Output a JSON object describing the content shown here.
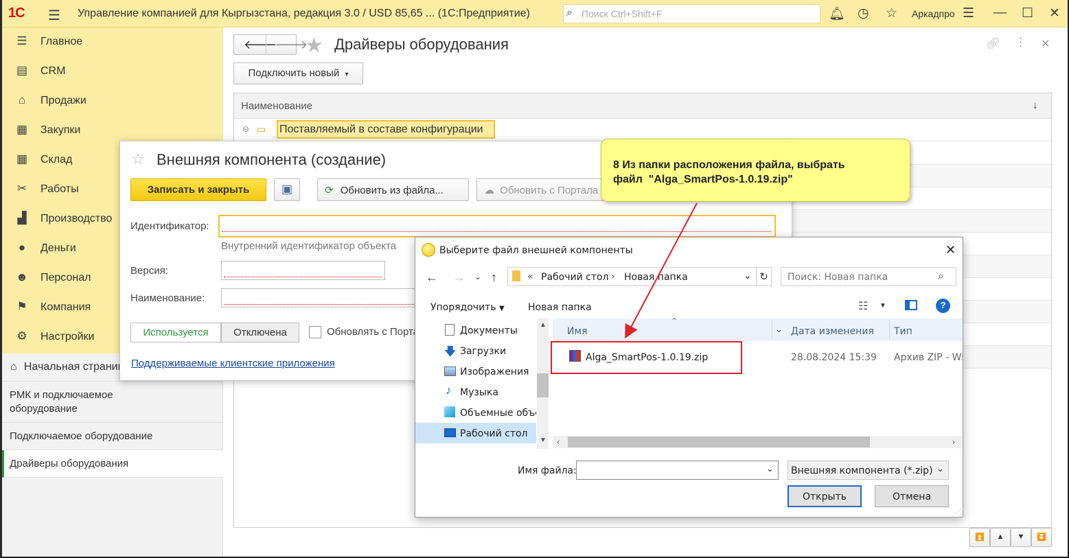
{
  "app": {
    "logo": "1С",
    "title": "Управление компанией для Кыргызстана, редакция 3.0 / USD 85,65 ... (1С:Предприятие)",
    "search_placeholder": "Поиск Ctrl+Shift+F",
    "user": "Аркадпро"
  },
  "sidebar": {
    "items": [
      {
        "label": "Главное",
        "icon": "menu-icon"
      },
      {
        "label": "CRM",
        "icon": "crm-icon"
      },
      {
        "label": "Продажи",
        "icon": "basket-icon"
      },
      {
        "label": "Закупки",
        "icon": "cart-icon"
      },
      {
        "label": "Склад",
        "icon": "warehouse-icon"
      },
      {
        "label": "Работы",
        "icon": "tools-icon"
      },
      {
        "label": "Производство",
        "icon": "factory-icon"
      },
      {
        "label": "Деньги",
        "icon": "money-icon"
      },
      {
        "label": "Персонал",
        "icon": "people-icon"
      },
      {
        "label": "Компания",
        "icon": "flag-icon"
      },
      {
        "label": "Настройки",
        "icon": "gear-icon"
      }
    ],
    "home": "Начальная страница",
    "open_windows": [
      "РМК и подключаемое оборудование",
      "Подключаемое оборудование",
      "Драйверы оборудования"
    ]
  },
  "main": {
    "title": "Драйверы оборудования",
    "connect_new": "Подключить новый",
    "column_header": "Наименование",
    "group_row": "Поставляемый в составе конфигурации"
  },
  "component_dialog": {
    "title": "Внешняя компонента (создание)",
    "save_close": "Записать и закрыть",
    "update_from_file": "Обновить из файла...",
    "update_from_portal": "Обновить с Портала",
    "identifier_label": "Идентификатор:",
    "identifier_hint": "Внутренний идентификатор объекта",
    "version_label": "Версия:",
    "name_label": "Наименование:",
    "used": "Используется",
    "disabled": "Отключена",
    "update_from_portal_check": "Обновлять с Портала",
    "supported_clients_link": "Поддерживаемые клиентские приложения"
  },
  "file_dialog": {
    "title": "Выберите файл внешней компоненты",
    "breadcrumb_prefix": "«",
    "path": [
      "Рабочий стол",
      "Новая папка"
    ],
    "search_placeholder": "Поиск: Новая папка",
    "organize": "Упорядочить",
    "new_folder": "Новая папка",
    "tree": [
      "Документы",
      "Загрузки",
      "Изображения",
      "Музыка",
      "Объемные объекты",
      "Рабочий стол"
    ],
    "columns": {
      "name": "Имя",
      "date": "Дата изменения",
      "type": "Тип"
    },
    "files": [
      {
        "name": "Alga_SmartPos-1.0.19.zip",
        "date": "28.08.2024 15:39",
        "type": "Архив ZIP - WinRAR"
      }
    ],
    "filename_label": "Имя файла:",
    "filename_value": "",
    "filter": "Внешняя компонента (*.zip)",
    "open": "Открыть",
    "cancel": "Отмена"
  },
  "callout": {
    "text_line1": "8 Из папки расположения файла, выбрать",
    "text_line2": "файл  \"Alga_SmartPos-1.0.19.zip\""
  },
  "colors": {
    "header_yellow": "#fbeda3",
    "primary_button": "#f6d31b",
    "callout": "#ffff8a",
    "highlight_red": "#e0202a",
    "link": "#1a4aa0",
    "active_toggle": "#2e9b3b"
  }
}
